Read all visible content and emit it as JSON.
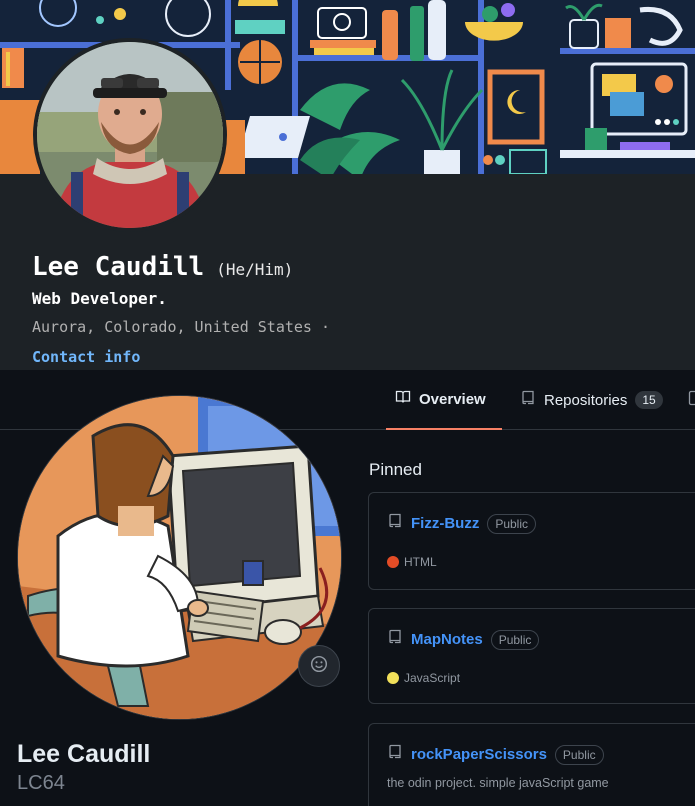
{
  "linkedin": {
    "name": "Lee Caudill",
    "pronouns": "(He/Him)",
    "headline": "Web Developer.",
    "location": "Aurora, Colorado, United States ·",
    "contact_label": "Contact info",
    "colors": {
      "card_bg": "#1d2226",
      "link": "#71b7fb"
    }
  },
  "github": {
    "tabs": [
      {
        "label": "Overview",
        "icon": "book-icon",
        "active": true
      },
      {
        "label": "Repositories",
        "icon": "repo-icon",
        "count": "15"
      }
    ],
    "name": "Lee Caudill",
    "login": "LC64",
    "status_icon": "smiley-icon",
    "pinned_title": "Pinned",
    "pinned": [
      {
        "name": "Fizz-Buzz",
        "visibility": "Public",
        "language": "HTML",
        "language_color": "#e34c26"
      },
      {
        "name": "MapNotes",
        "visibility": "Public",
        "language": "JavaScript",
        "language_color": "#f1e05a"
      },
      {
        "name": "rockPaperScissors",
        "visibility": "Public",
        "description": "the odin project. simple javaScript game"
      }
    ],
    "colors": {
      "bg": "#0d1117",
      "border": "#30363d",
      "link": "#4493f8",
      "active_tab": "#f78166"
    }
  }
}
